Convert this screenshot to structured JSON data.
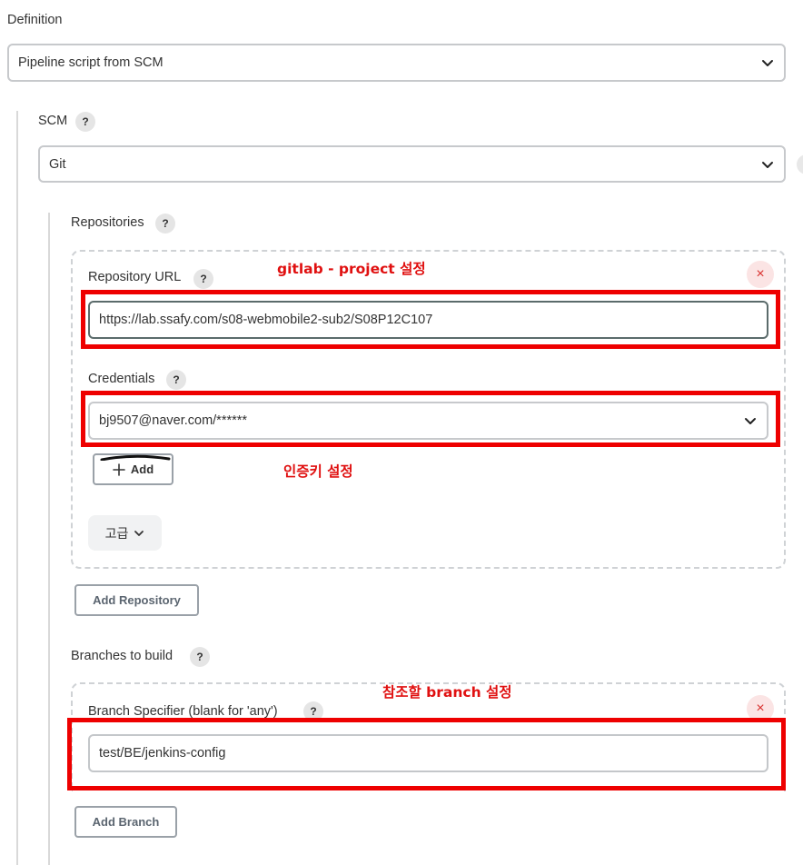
{
  "definition": {
    "label": "Definition",
    "value": "Pipeline script from SCM"
  },
  "scm": {
    "label": "SCM",
    "value": "Git",
    "help": "?"
  },
  "repositories": {
    "label": "Repositories",
    "help": "?",
    "repo_url_label": "Repository URL",
    "repo_url_value": "https://lab.ssafy.com/s08-webmobile2-sub2/S08P12C107",
    "credentials_label": "Credentials",
    "credentials_value": "bj9507@naver.com/******",
    "add_label": "Add",
    "advanced_label": "고급",
    "add_repository_label": "Add Repository",
    "remove_symbol": "×"
  },
  "branches": {
    "label": "Branches to build",
    "help": "?",
    "specifier_label": "Branch Specifier (blank for 'any')",
    "specifier_value": "test/BE/jenkins-config",
    "add_branch_label": "Add Branch",
    "remove_symbol": "×"
  },
  "annotations": {
    "repo_note": "gitlab - project 설정",
    "credentials_note": "인증키 설정",
    "branch_note": "참조할 branch 설정"
  },
  "colors": {
    "annotation_red": "#ee0000",
    "remove_red": "#d9322f",
    "border_gray": "#c7c9cc"
  }
}
